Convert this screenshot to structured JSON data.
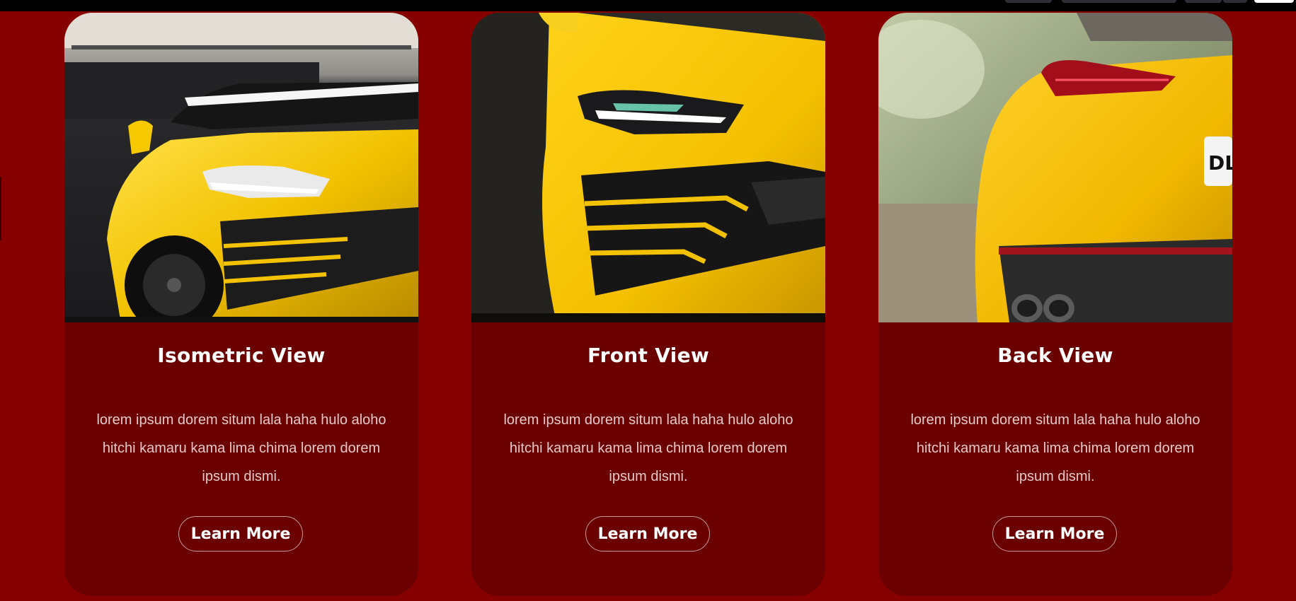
{
  "theme": {
    "page_bg": "#870000",
    "card_bg": "#6a0000",
    "accent_yellow": "#f2c200",
    "text_white": "#ffffff"
  },
  "cards": [
    {
      "title": "Isometric View",
      "description": "lorem ipsum dorem situm lala haha hulo aloho hitchi kamaru kama lima chima lorem dorem ipsum dismi.",
      "button_label": "Learn More",
      "image": "yellow-suv-isometric-photo"
    },
    {
      "title": "Front View",
      "description": "lorem ipsum dorem situm lala haha hulo aloho hitchi kamaru kama lima chima lorem dorem ipsum dismi.",
      "button_label": "Learn More",
      "image": "yellow-suv-front-photo"
    },
    {
      "title": "Back View",
      "description": "lorem ipsum dorem situm lala haha hulo aloho hitchi kamaru kama lima chima lorem dorem ipsum dismi.",
      "button_label": "Learn More",
      "image": "yellow-suv-rear-photo"
    }
  ]
}
